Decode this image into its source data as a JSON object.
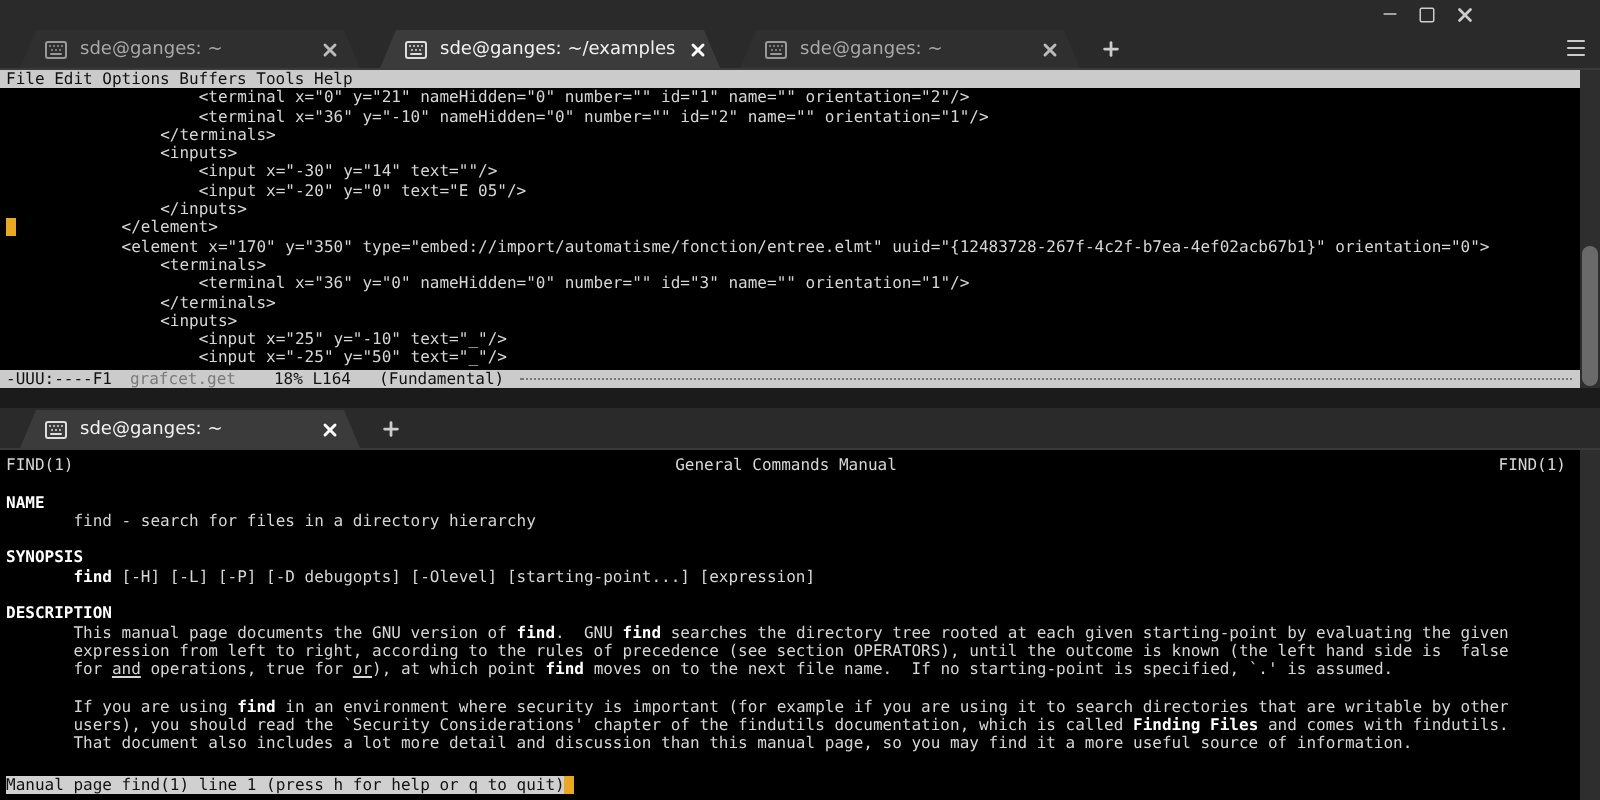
{
  "top_tabs": [
    {
      "title": "sde@ganges: ~",
      "selected": false
    },
    {
      "title": "sde@ganges: ~/examples",
      "selected": true
    },
    {
      "title": "sde@ganges: ~",
      "selected": false
    }
  ],
  "editor": {
    "menu": [
      "File",
      "Edit",
      "Options",
      "Buffers",
      "Tools",
      "Help"
    ],
    "lines": [
      {
        "text": "                    <terminal x=\"0\" y=\"21\" nameHidden=\"0\" number=\"\" id=\"1\" name=\"\" orientation=\"2\"/>",
        "cursor": false
      },
      {
        "text": "                    <terminal x=\"36\" y=\"-10\" nameHidden=\"0\" number=\"\" id=\"2\" name=\"\" orientation=\"1\"/>",
        "cursor": false
      },
      {
        "text": "                </terminals>",
        "cursor": false
      },
      {
        "text": "                <inputs>",
        "cursor": false
      },
      {
        "text": "                    <input x=\"-30\" y=\"14\" text=\"\"/>",
        "cursor": false
      },
      {
        "text": "                    <input x=\"-20\" y=\"0\" text=\"E 05\"/>",
        "cursor": false
      },
      {
        "text": "                </inputs>",
        "cursor": false
      },
      {
        "text": "           </element>",
        "cursor": true
      },
      {
        "text": "            <element x=\"170\" y=\"350\" type=\"embed://import/automatisme/fonction/entree.elmt\" uuid=\"{12483728-267f-4c2f-b7ea-4ef02acb67b1}\" orientation=\"0\">",
        "cursor": false
      },
      {
        "text": "                <terminals>",
        "cursor": false
      },
      {
        "text": "                    <terminal x=\"36\" y=\"0\" nameHidden=\"0\" number=\"\" id=\"3\" name=\"\" orientation=\"1\"/>",
        "cursor": false
      },
      {
        "text": "                </terminals>",
        "cursor": false
      },
      {
        "text": "                <inputs>",
        "cursor": false
      },
      {
        "text": "                    <input x=\"25\" y=\"-10\" text=\"_\"/>",
        "cursor": false
      },
      {
        "text": "                    <input x=\"-25\" y=\"50\" text=\"_\"/>",
        "cursor": false
      }
    ],
    "mode_line": {
      "status": "-UUU:----F1",
      "buffer": "grafcet.get",
      "position": "18% L164",
      "mode": "(Fundamental)"
    }
  },
  "bottom_tabs": [
    {
      "title": "sde@ganges: ~",
      "selected": true
    }
  ],
  "man_page": {
    "header": {
      "left": "FIND(1)",
      "center": "General Commands Manual",
      "right": "FIND(1)"
    },
    "sections": [
      {
        "heading": "NAME",
        "paragraphs": [
          [
            "find - search for files in a directory hierarchy"
          ]
        ]
      },
      {
        "heading": "SYNOPSIS",
        "paragraphs": [
          [
            "**find** [-H] [-L] [-P] [-D debugopts] [-Olevel] [starting-point...] [expression]"
          ]
        ]
      },
      {
        "heading": "DESCRIPTION",
        "paragraphs": [
          [
            "This manual page documents the GNU version of **find**.  GNU **find** searches the directory tree rooted at each given starting-point by evaluating the given",
            "expression from left to right, according to the rules of precedence (see section OPERATORS), until the outcome is known (the left hand side is  false",
            "for *and* operations, true for *or*), at which point **find** moves on to the next file name.  If no starting-point is specified, `.' is assumed."
          ],
          [
            "If you are using **find** in an environment where security is important (for example if you are using it to search directories that are writable by other",
            "users), you should read the `Security Considerations' chapter of the findutils documentation, which is called **Finding Files** and comes with findutils.",
            "That document also includes a lot more detail and discussion than this manual page, so you may find it a more useful source of information."
          ]
        ]
      }
    ],
    "prompt": "Manual page find(1) line 1 (press h for help or q to quit)"
  }
}
